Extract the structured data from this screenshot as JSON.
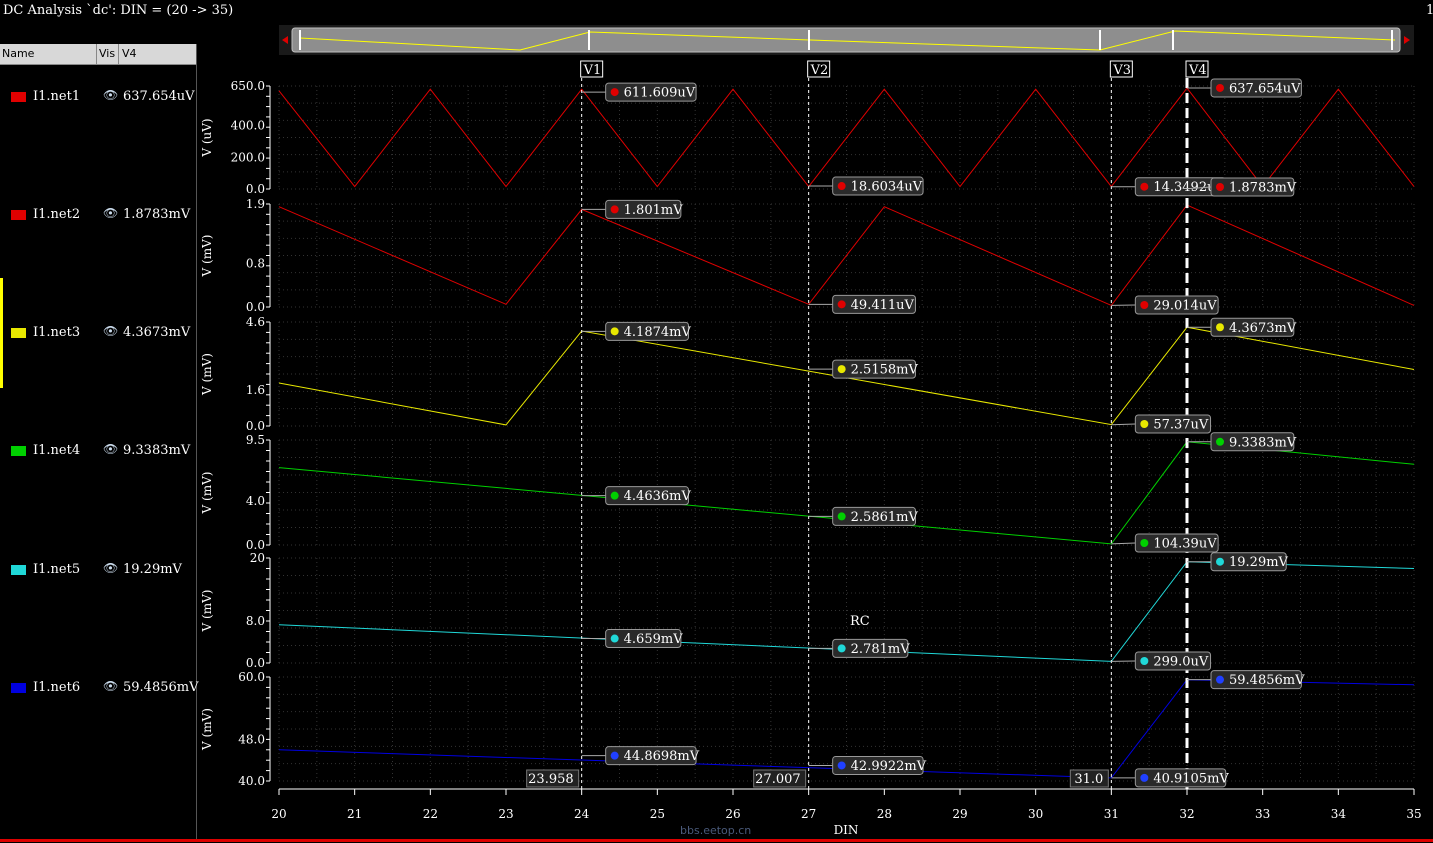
{
  "window": {
    "title": "DC Analysis `dc': DIN = (20 -> 35)",
    "title_right": "1"
  },
  "panel": {
    "headers": {
      "name": "Name",
      "vis": "Vis",
      "v4": "V4"
    },
    "signals": [
      {
        "name": "I1.net1",
        "value": "637.654uV",
        "color": "#e00000"
      },
      {
        "name": "I1.net2",
        "value": "1.8783mV",
        "color": "#e00000"
      },
      {
        "name": "I1.net3",
        "value": "4.3673mV",
        "color": "#e8e800"
      },
      {
        "name": "I1.net4",
        "value": "9.3383mV",
        "color": "#00d000"
      },
      {
        "name": "I1.net5",
        "value": "19.29mV",
        "color": "#20d8d8"
      },
      {
        "name": "I1.net6",
        "value": "59.4856mV",
        "color": "#0000e0"
      }
    ]
  },
  "annotation": {
    "text": "RC",
    "color": "#ff1a1a"
  },
  "watermark": "bbs.eetop.cn",
  "cursors": [
    {
      "label": "V1",
      "x": 24.0,
      "readout": "23.958"
    },
    {
      "label": "V2",
      "x": 27.0,
      "readout": "27.007"
    },
    {
      "label": "V3",
      "x": 31.0,
      "readout": "31.0"
    },
    {
      "label": "V4",
      "x": 32.0,
      "readout": ""
    }
  ],
  "chart_data": {
    "type": "line",
    "xlabel": "DIN",
    "xlim": [
      20,
      35
    ],
    "xticks": [
      20,
      21,
      22,
      23,
      24,
      25,
      26,
      27,
      28,
      29,
      30,
      31,
      32,
      33,
      34,
      35
    ],
    "strips": [
      {
        "signal": "I1.net1",
        "color": "#e00000",
        "ylabel": "V (uV)",
        "ylim": [
          0,
          650
        ],
        "yticks": [
          {
            "v": 650,
            "t": "650.0"
          },
          {
            "v": 400,
            "t": "400.0"
          },
          {
            "v": 200,
            "t": "200.0"
          },
          {
            "v": 0,
            "t": "0.0"
          }
        ],
        "x": [
          20,
          21,
          22,
          23,
          24,
          25,
          26,
          27,
          28,
          29,
          30,
          31,
          32,
          33,
          34,
          35
        ],
        "y": [
          620,
          15,
          630,
          15,
          630,
          15,
          630,
          15,
          630,
          15,
          630,
          15,
          637,
          15,
          630,
          15
        ],
        "markers": [
          {
            "x": 24,
            "y": 611.609,
            "text": "611.609uV"
          },
          {
            "x": 27,
            "y": 18.6034,
            "text": "18.6034uV"
          },
          {
            "x": 31,
            "y": 14.3492,
            "text": "14.3492uV"
          },
          {
            "x": 32,
            "y": 637.654,
            "text": "637.654uV"
          },
          {
            "x": 32,
            "y": 1.8783,
            "text": "1.8783mV"
          }
        ]
      },
      {
        "signal": "I1.net2",
        "color": "#e00000",
        "ylabel": "V (mV)",
        "ylim": [
          0,
          1.9
        ],
        "yticks": [
          {
            "v": 1.9,
            "t": "1.9"
          },
          {
            "v": 0.8,
            "t": "0.8"
          },
          {
            "v": 0,
            "t": "0.0"
          }
        ],
        "x": [
          20,
          23,
          24,
          27,
          28,
          31,
          32,
          35
        ],
        "y": [
          1.85,
          0.05,
          1.8,
          0.05,
          1.85,
          0.03,
          1.88,
          0.03
        ],
        "markers": [
          {
            "x": 24,
            "y": 1.801,
            "text": "1.801mV"
          },
          {
            "x": 27,
            "y": 0.049,
            "text": "49.411uV"
          },
          {
            "x": 31,
            "y": 0.029,
            "text": "29.014uV"
          }
        ]
      },
      {
        "signal": "I1.net3",
        "color": "#e8e800",
        "ylabel": "V (mV)",
        "ylim": [
          0,
          4.6
        ],
        "yticks": [
          {
            "v": 4.6,
            "t": "4.6"
          },
          {
            "v": 1.6,
            "t": "1.6"
          },
          {
            "v": 0,
            "t": "0.0"
          }
        ],
        "x": [
          20,
          23,
          24,
          31,
          32,
          35
        ],
        "y": [
          1.9,
          0.05,
          4.2,
          0.06,
          4.37,
          2.5
        ],
        "markers": [
          {
            "x": 24,
            "y": 4.1874,
            "text": "4.1874mV"
          },
          {
            "x": 27,
            "y": 2.5158,
            "text": "2.5158mV"
          },
          {
            "x": 31,
            "y": 0.057,
            "text": "57.37uV"
          },
          {
            "x": 32,
            "y": 4.3673,
            "text": "4.3673mV"
          }
        ]
      },
      {
        "signal": "I1.net4",
        "color": "#00d000",
        "ylabel": "V (mV)",
        "ylim": [
          0,
          9.5
        ],
        "yticks": [
          {
            "v": 9.5,
            "t": "9.5"
          },
          {
            "v": 4.0,
            "t": "4.0"
          },
          {
            "v": 0,
            "t": "0.0"
          }
        ],
        "x": [
          20,
          31,
          32,
          35
        ],
        "y": [
          7.0,
          0.1,
          9.34,
          7.3
        ],
        "markers": [
          {
            "x": 24,
            "y": 4.4636,
            "text": "4.4636mV"
          },
          {
            "x": 27,
            "y": 2.5861,
            "text": "2.5861mV"
          },
          {
            "x": 31,
            "y": 0.104,
            "text": "104.39uV"
          },
          {
            "x": 32,
            "y": 9.3383,
            "text": "9.3383mV"
          }
        ]
      },
      {
        "signal": "I1.net5",
        "color": "#20d8d8",
        "ylabel": "V (mV)",
        "ylim": [
          0,
          20
        ],
        "yticks": [
          {
            "v": 20,
            "t": "20"
          },
          {
            "v": 8.0,
            "t": "8.0"
          },
          {
            "v": 0,
            "t": "0.0"
          }
        ],
        "x": [
          20,
          31,
          32,
          35
        ],
        "y": [
          7.3,
          0.3,
          19.29,
          18.0
        ],
        "markers": [
          {
            "x": 24,
            "y": 4.659,
            "text": "4.659mV"
          },
          {
            "x": 27,
            "y": 2.781,
            "text": "2.781mV"
          },
          {
            "x": 31,
            "y": 0.299,
            "text": "299.0uV"
          },
          {
            "x": 32,
            "y": 19.29,
            "text": "19.29mV"
          }
        ]
      },
      {
        "signal": "I1.net6",
        "color": "#0000e0",
        "ylabel": "V (mV)",
        "ylim": [
          40,
          60
        ],
        "yticks": [
          {
            "v": 60,
            "t": "60.0"
          },
          {
            "v": 48,
            "t": "48.0"
          },
          {
            "v": 40,
            "t": "40.0"
          }
        ],
        "x": [
          20,
          31,
          32,
          35
        ],
        "y": [
          46.0,
          40.6,
          59.49,
          58.5
        ],
        "markers": [
          {
            "x": 24,
            "y": 44.8698,
            "text": "44.8698mV"
          },
          {
            "x": 27,
            "y": 42.9922,
            "text": "42.9922mV"
          },
          {
            "x": 31,
            "y": 40.6,
            "text": "40.9105mV"
          },
          {
            "x": 32,
            "y": 59.4856,
            "text": "59.4856mV"
          }
        ]
      }
    ]
  }
}
